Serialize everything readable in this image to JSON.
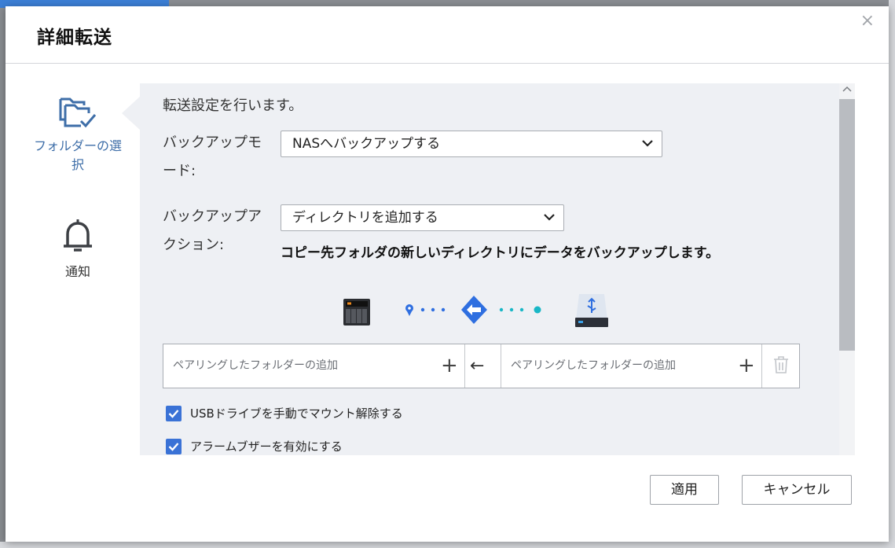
{
  "dialog": {
    "title": "詳細転送",
    "close_glyph": "×"
  },
  "nav": {
    "items": [
      {
        "label": "フォルダーの選択",
        "icon": "folder-check-icon",
        "active": true
      },
      {
        "label": "通知",
        "icon": "bell-icon",
        "active": false
      }
    ]
  },
  "content": {
    "intro": "転送設定を行います。",
    "backup_mode": {
      "label": "バックアップモード:",
      "value": "NASへバックアップする"
    },
    "backup_action": {
      "label": "バックアップアクション:",
      "value": "ディレクトリを追加する",
      "description": "コピー先フォルダの新しいディレクトリにデータをバックアップします。"
    },
    "diagram": {
      "source_icon": "nas-icon",
      "direction_icon": "arrow-left-icon",
      "destination_icon": "usb-drive-icon"
    },
    "pairing": {
      "left_placeholder": "ペアリングしたフォルダーの追加",
      "right_placeholder": "ペアリングしたフォルダーの追加",
      "plus_glyph": "+",
      "arrow_glyph": "←"
    },
    "options": [
      {
        "label": "USBドライブを手動でマウント解除する",
        "checked": true
      },
      {
        "label": "アラームブザーを有効にする",
        "checked": true
      }
    ]
  },
  "buttons": {
    "apply": "適用",
    "cancel": "キャンセル"
  },
  "colors": {
    "accent": "#3a72d6",
    "nav_active": "#3e6ea8",
    "panel_bg": "#eef0f4",
    "diagram_blue": "#2f6fe0",
    "diagram_teal": "#19b7c6"
  }
}
